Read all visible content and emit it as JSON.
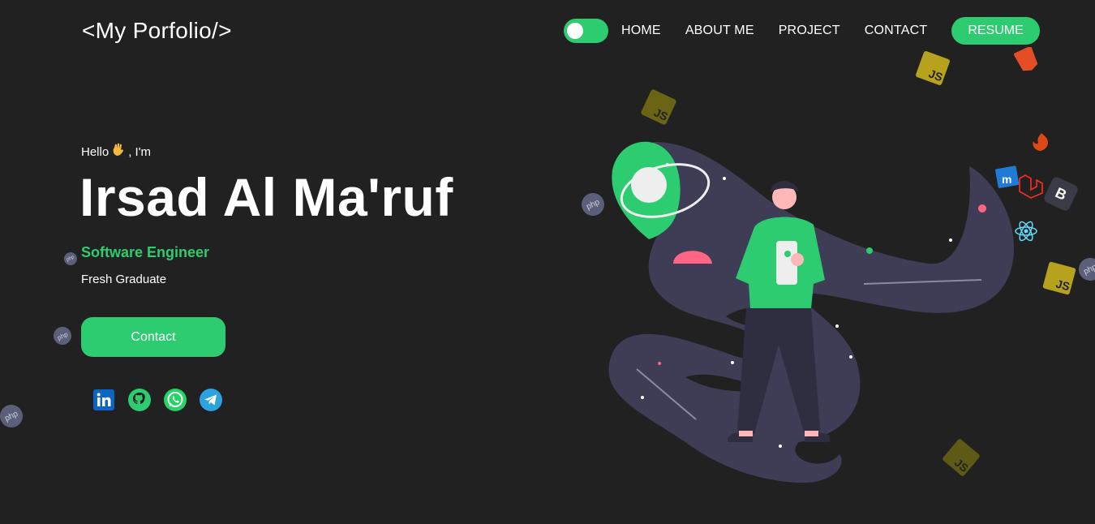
{
  "header": {
    "logo": "<My Porfolio/>",
    "nav": [
      "HOME",
      "ABOUT ME",
      "PROJECT",
      "CONTACT"
    ],
    "resume_label": "RESUME",
    "theme_toggle": "on"
  },
  "hero": {
    "greeting_start": "Hello",
    "greeting_end": ", I'm",
    "name": "Irsad Al Ma'ruf",
    "role": "Software Engineer",
    "status": "Fresh Graduate",
    "contact_label": "Contact"
  },
  "socials": [
    "linkedin-icon",
    "github-icon",
    "whatsapp-icon",
    "telegram-icon"
  ],
  "floating_icons": {
    "php": "php",
    "js": "JS",
    "bootstrap": "B"
  },
  "colors": {
    "background": "#212121",
    "accent": "#2ecc71",
    "blob": "#3f3d56",
    "pink": "#ff6584"
  }
}
